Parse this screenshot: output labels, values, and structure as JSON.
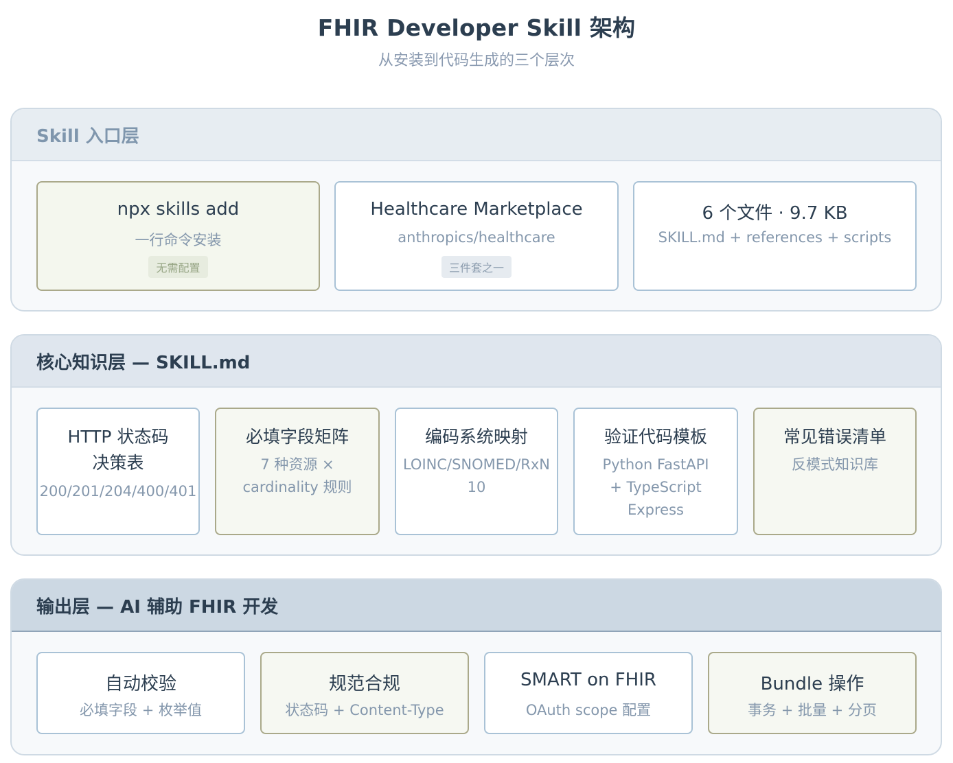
{
  "title": "FHIR Developer Skill 架构",
  "subtitle": "从安装到代码生成的三个层次",
  "layers": [
    {
      "name": "Skill 入口层",
      "cards": [
        {
          "title": "npx skills add",
          "sub": "一行命令安装",
          "tag": "无需配置"
        },
        {
          "title": "Healthcare Marketplace",
          "sub": "anthropics/healthcare",
          "tag": "三件套之一"
        },
        {
          "title": "6 个文件 · 9.7 KB",
          "sub": "SKILL.md + references + scripts"
        }
      ]
    },
    {
      "name": "核心知识层 — SKILL.md",
      "cards": [
        {
          "title": "HTTP 状态码\n决策表",
          "sub": "200/201/204/400/401"
        },
        {
          "title": "必填字段矩阵",
          "sub": "7 种资源 ×\ncardinality 规则"
        },
        {
          "title": "编码系统映射",
          "sub": "LOINC/SNOMED/RxN\n10"
        },
        {
          "title": "验证代码模板",
          "sub": "Python FastAPI\n+ TypeScript\nExpress"
        },
        {
          "title": "常见错误清单",
          "sub": "反模式知识库"
        }
      ]
    },
    {
      "name": "输出层 — AI 辅助 FHIR 开发",
      "cards": [
        {
          "title": "自动校验",
          "sub": "必填字段 + 枚举值"
        },
        {
          "title": "规范合规",
          "sub": "状态码 + Content-Type"
        },
        {
          "title": "SMART on FHIR",
          "sub": "OAuth scope 配置"
        },
        {
          "title": "Bundle 操作",
          "sub": "事务 + 批量 + 分页"
        }
      ]
    }
  ],
  "colors": {
    "layer1_header": "#e7edf2",
    "layer1_title": "#7f96ad",
    "layer2_header": "#dfe6ee",
    "layer3_header": "#ccd8e3",
    "green_tag_bg": "#e7ecdf",
    "blue_tag_bg": "#e6ebf0"
  }
}
